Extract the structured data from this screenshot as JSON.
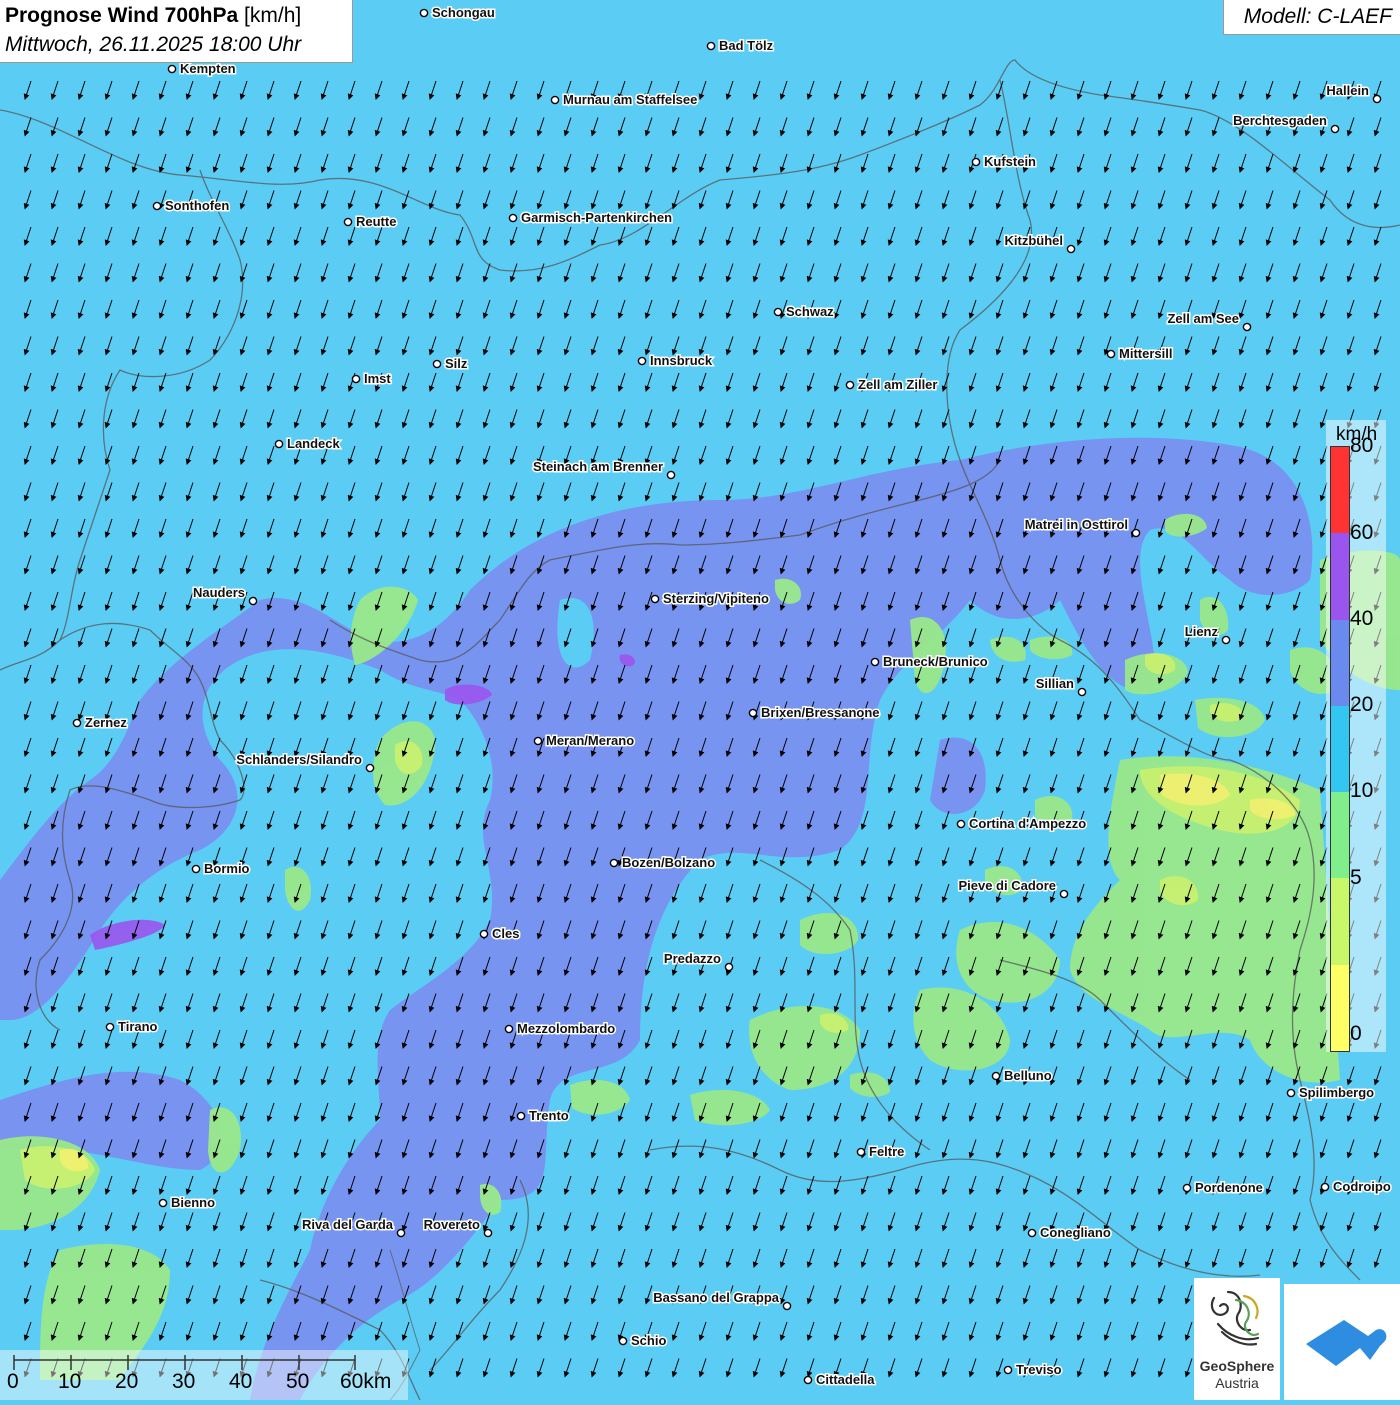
{
  "header": {
    "title_bold": "Prognose Wind 700hPa",
    "title_unit": "[km/h]",
    "subtitle": "Mittwoch, 26.11.2025 18:00 Uhr",
    "model": "Modell: C-LAEF"
  },
  "legend": {
    "unit": "km/h",
    "levels": [
      {
        "label": "0",
        "color": "#ffff66"
      },
      {
        "label": "5",
        "color": "#c9f76a"
      },
      {
        "label": "10",
        "color": "#80ee8a"
      },
      {
        "label": "20",
        "color": "#33c6f0"
      },
      {
        "label": "40",
        "color": "#6a8af0"
      },
      {
        "label": "60",
        "color": "#9a55ee"
      },
      {
        "label": "80",
        "color": "#ff3333"
      }
    ]
  },
  "colors": {
    "background": "#5bcdf5",
    "zone_40_60": "#7b8ff0",
    "zone_10_20": "#9ae88a",
    "zone_5_10": "#c8f070",
    "zone_0_5": "#f2f070"
  },
  "wind": {
    "direction_from": "NNE",
    "arrow_icon": "wind-arrow-icon"
  },
  "cities": [
    {
      "name": "Schongau",
      "label_side": "right"
    },
    {
      "name": "Bad Tölz",
      "label_side": "right"
    },
    {
      "name": "Kempten",
      "label_side": "right"
    },
    {
      "name": "Murnau am Staffelsee",
      "label_side": "right"
    },
    {
      "name": "Hallein",
      "label_side": "left"
    },
    {
      "name": "Berchtesgaden",
      "label_side": "left"
    },
    {
      "name": "Kufstein",
      "label_side": "right"
    },
    {
      "name": "Sonthofen",
      "label_side": "right"
    },
    {
      "name": "Reutte",
      "label_side": "right"
    },
    {
      "name": "Garmisch-Partenkirchen",
      "label_side": "right"
    },
    {
      "name": "Kitzbühel",
      "label_side": "left"
    },
    {
      "name": "Schwaz",
      "label_side": "right"
    },
    {
      "name": "Zell am See",
      "label_side": "left"
    },
    {
      "name": "Mittersill",
      "label_side": "right"
    },
    {
      "name": "Silz",
      "label_side": "right"
    },
    {
      "name": "Innsbruck",
      "label_side": "right"
    },
    {
      "name": "Imst",
      "label_side": "right"
    },
    {
      "name": "Zell am Ziller",
      "label_side": "right"
    },
    {
      "name": "Landeck",
      "label_side": "right"
    },
    {
      "name": "Steinach am Brenner",
      "label_side": "left"
    },
    {
      "name": "Matrei in Osttirol",
      "label_side": "left"
    },
    {
      "name": "Nauders",
      "label_side": "left"
    },
    {
      "name": "Sterzing/Vipiteno",
      "label_side": "right"
    },
    {
      "name": "Lienz",
      "label_side": "left"
    },
    {
      "name": "Bruneck/Brunico",
      "label_side": "right"
    },
    {
      "name": "Sillian",
      "label_side": "left"
    },
    {
      "name": "Brixen/Bressanone",
      "label_side": "right"
    },
    {
      "name": "Zernez",
      "label_side": "right"
    },
    {
      "name": "Meran/Merano",
      "label_side": "right"
    },
    {
      "name": "Schlanders/Silandro",
      "label_side": "left"
    },
    {
      "name": "Cortina d'Ampezzo",
      "label_side": "right"
    },
    {
      "name": "Bozen/Bolzano",
      "label_side": "right"
    },
    {
      "name": "Bormio",
      "label_side": "right"
    },
    {
      "name": "Pieve di Cadore",
      "label_side": "left"
    },
    {
      "name": "Cles",
      "label_side": "right"
    },
    {
      "name": "Predazzo",
      "label_side": "left"
    },
    {
      "name": "Tirano",
      "label_side": "right"
    },
    {
      "name": "Mezzolombardo",
      "label_side": "right"
    },
    {
      "name": "Belluno",
      "label_side": "right"
    },
    {
      "name": "Spilimbergo",
      "label_side": "right"
    },
    {
      "name": "Trento",
      "label_side": "right"
    },
    {
      "name": "Feltre",
      "label_side": "right"
    },
    {
      "name": "Pordenone",
      "label_side": "right"
    },
    {
      "name": "Codroipo",
      "label_side": "right"
    },
    {
      "name": "Bienno",
      "label_side": "right"
    },
    {
      "name": "Riva del Garda",
      "label_side": "left"
    },
    {
      "name": "Rovereto",
      "label_side": "left"
    },
    {
      "name": "Conegliano",
      "label_side": "right"
    },
    {
      "name": "Bassano del Grappa",
      "label_side": "left"
    },
    {
      "name": "Schio",
      "label_side": "right"
    },
    {
      "name": "Treviso",
      "label_side": "right"
    },
    {
      "name": "Cittadella",
      "label_side": "right"
    }
  ],
  "scale": {
    "ticks": [
      "0",
      "10",
      "20",
      "30",
      "40",
      "50",
      "60km"
    ]
  },
  "logos": {
    "geosphere_line1": "GeoSphere",
    "geosphere_line2": "Austria"
  }
}
